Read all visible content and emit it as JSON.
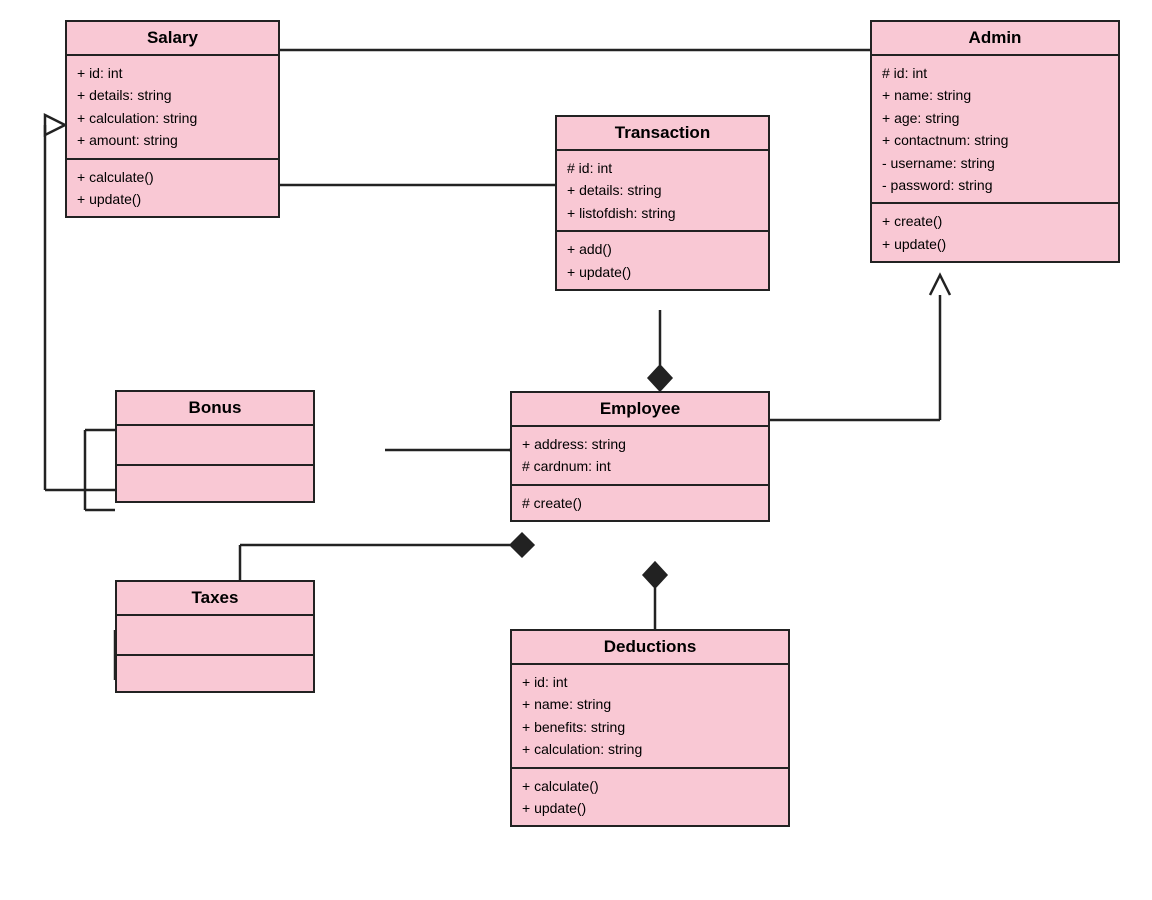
{
  "classes": {
    "salary": {
      "title": "Salary",
      "attributes": "+ id: int\n+ details: string\n+ calculation: string\n+ amount: string",
      "methods": "+ calculate()\n+ update()"
    },
    "admin": {
      "title": "Admin",
      "attributes": "# id: int\n+ name: string\n+ age: string\n+ contactnum: string\n- username: string\n- password: string",
      "methods": "+ create()\n+ update()"
    },
    "transaction": {
      "title": "Transaction",
      "attributes": "# id: int\n+ details: string\n+ listofdish: string",
      "methods": "+ add()\n+ update()"
    },
    "bonus": {
      "title": "Bonus",
      "attributes": "",
      "methods": ""
    },
    "employee": {
      "title": "Employee",
      "attributes": "+ address: string\n# cardnum: int",
      "methods": "# create()"
    },
    "taxes": {
      "title": "Taxes",
      "attributes": "",
      "methods": ""
    },
    "deductions": {
      "title": "Deductions",
      "attributes": "+ id: int\n+ name: string\n+ benefits: string\n+ calculation: string",
      "methods": "+ calculate()\n+ update()"
    }
  }
}
